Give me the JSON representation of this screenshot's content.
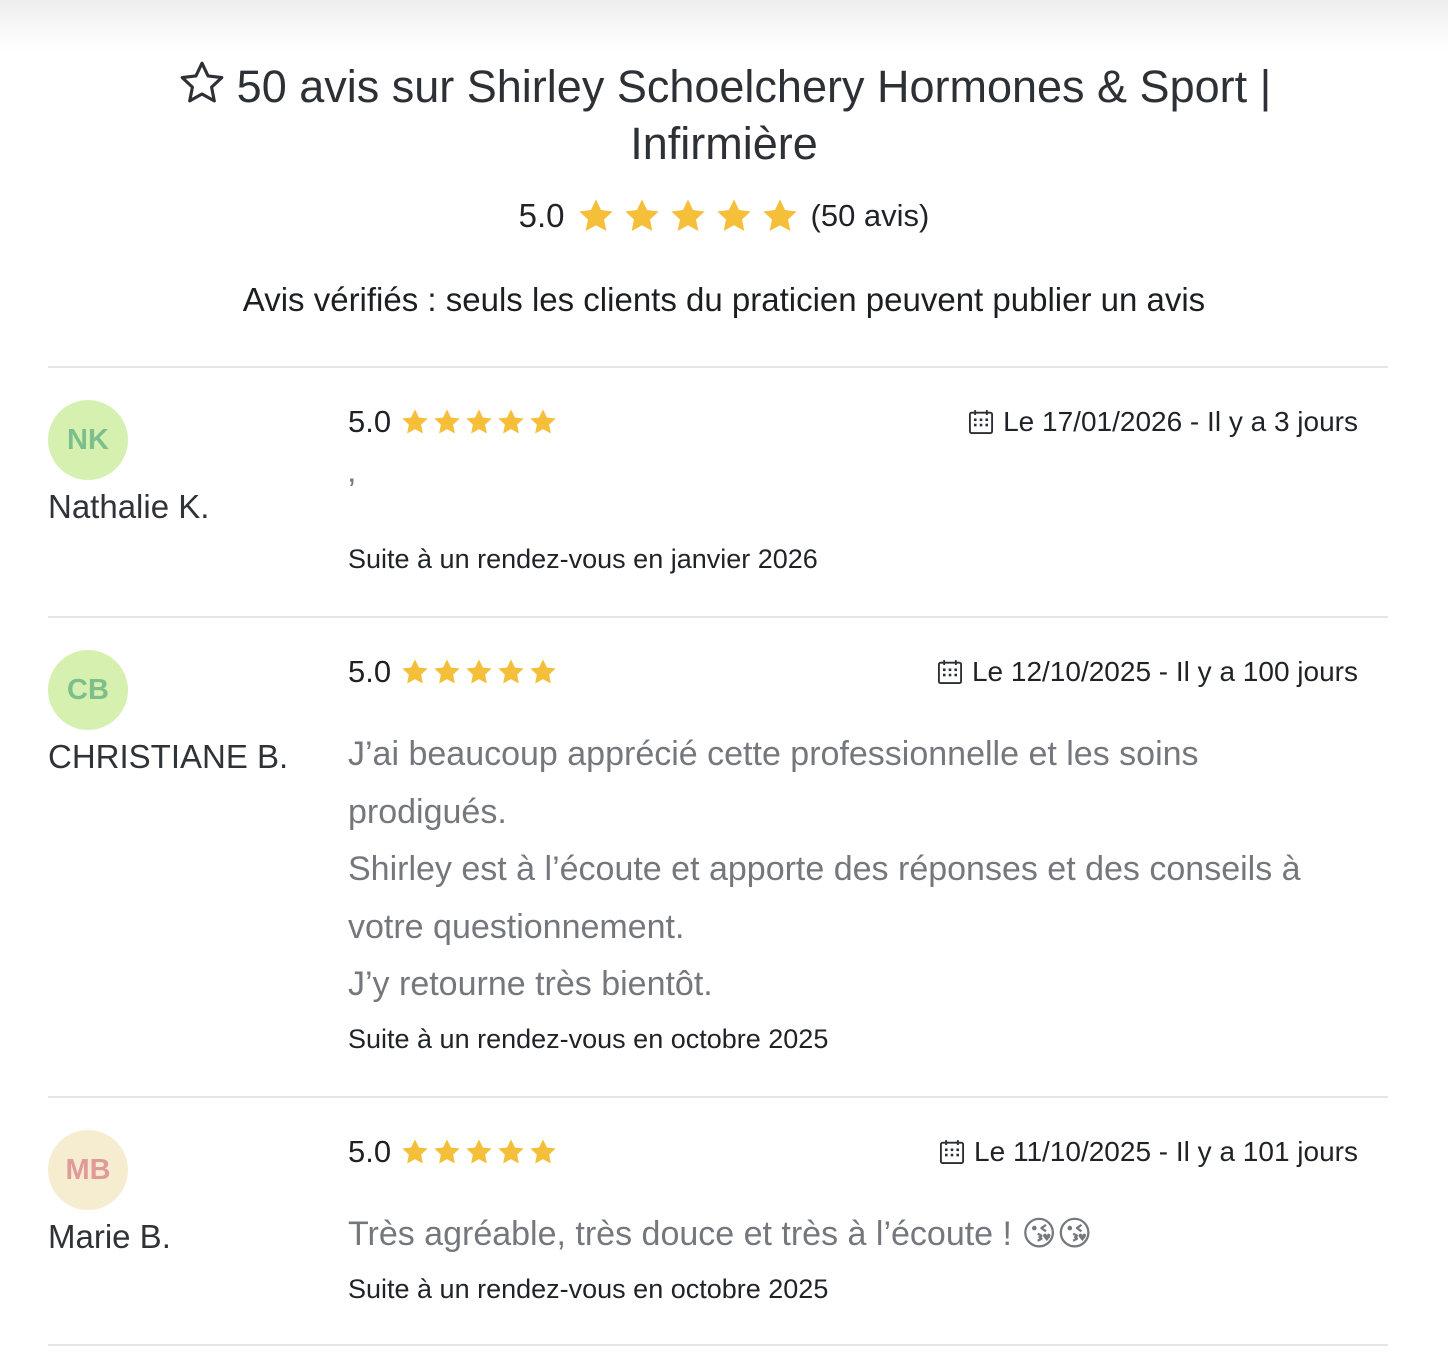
{
  "header": {
    "title": "50 avis sur Shirley Schoelchery Hormones & Sport | Infirmière",
    "rating_value": "5.0",
    "rating_count": "(50 avis)",
    "verified_note": "Avis vérifiés : seuls les clients du praticien peuvent publier un avis",
    "stars": 5
  },
  "reviews": [
    {
      "initials": "NK",
      "author": "Nathalie K.",
      "score": "5.0",
      "date": "Le 17/01/2026 - Il y a 3 jours",
      "comment_lines": [
        "’"
      ],
      "appointment": "Suite à un rendez-vous en janvier 2026",
      "avatar_bg": "#d6f0b0",
      "avatar_fg": "#7cbf8a"
    },
    {
      "initials": "CB",
      "author": "CHRISTIANE B.",
      "score": "5.0",
      "date": "Le 12/10/2025 - Il y a 100 jours",
      "comment_lines": [
        "J’ai beaucoup apprécié cette professionnelle et les soins prodigués.",
        "Shirley est à l’écoute et apporte des réponses et des conseils à votre questionnement.",
        "J’y retourne très bientôt."
      ],
      "appointment": "Suite à un rendez-vous en octobre 2025",
      "avatar_bg": "#d6f0b0",
      "avatar_fg": "#7cbf8a"
    },
    {
      "initials": "MB",
      "author": "Marie B.",
      "score": "5.0",
      "date": "Le 11/10/2025 - Il y a 101 jours",
      "comment_lines": [
        "Très agréable, très douce et très à l’écoute ! 😘😘"
      ],
      "appointment": "Suite à un rendez-vous en octobre 2025",
      "avatar_bg": "#f6ecd0",
      "avatar_fg": "#e09a9a"
    }
  ],
  "colors": {
    "star": "#f5bf3a",
    "divider": "#e6e6e8"
  }
}
